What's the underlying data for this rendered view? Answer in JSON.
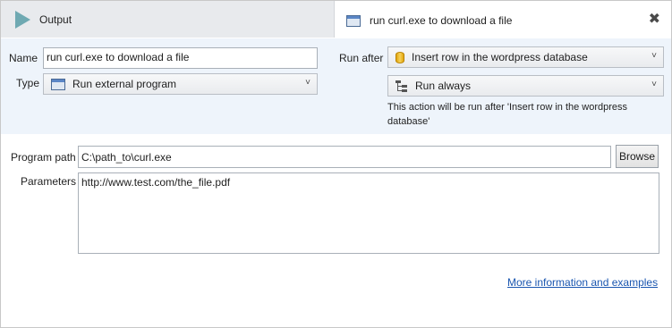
{
  "tabs": {
    "output_label": "Output",
    "action_label": "run curl.exe to download a file",
    "close_glyph": "✖"
  },
  "top": {
    "name_label": "Name",
    "name_value": "run curl.exe to download a file",
    "type_label": "Type",
    "type_value": "Run external program",
    "run_after_label": "Run after",
    "run_after_value": "Insert row in the wordpress database",
    "run_condition_value": "Run always",
    "note": "This action will be run after 'Insert row in the wordpress database'"
  },
  "program": {
    "path_label": "Program path",
    "path_value": "C:\\path_to\\curl.exe",
    "browse_label": "Browse",
    "params_label": "Parameters",
    "params_value": "http://www.test.com/the_file.pdf"
  },
  "link_text": "More information and examples",
  "icons": [
    "play-icon",
    "window-icon",
    "close-icon",
    "database-icon",
    "tree-icon",
    "chevron-down-icon"
  ],
  "colors": {
    "panel_bg": "#eef4fb",
    "link": "#1a56b0",
    "play": "#6fa9b2"
  }
}
